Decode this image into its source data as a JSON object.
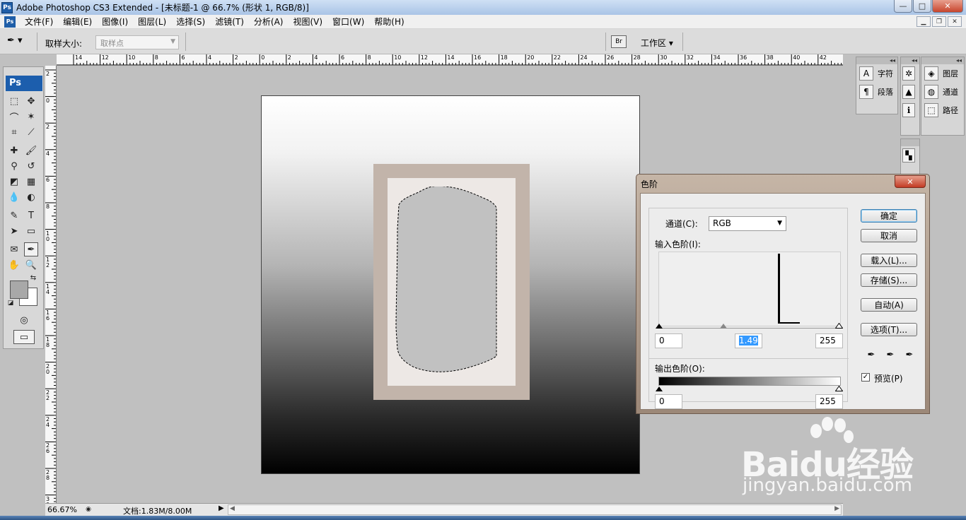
{
  "window": {
    "title": "Adobe Photoshop CS3 Extended - [未标题-1 @ 66.7% (形状 1, RGB/8)]",
    "minimize": "—",
    "maximize": "□",
    "close": "✕"
  },
  "menu": {
    "items": [
      "文件(F)",
      "编辑(E)",
      "图像(I)",
      "图层(L)",
      "选择(S)",
      "滤镜(T)",
      "分析(A)",
      "视图(V)",
      "窗口(W)",
      "帮助(H)"
    ]
  },
  "options_bar": {
    "sample_size_label": "取样大小:",
    "sample_size_value": "取样点",
    "workspace_label": "工作区 ▾"
  },
  "toolbox": {
    "logo": "Ps"
  },
  "rulers": {
    "top_labels": [
      "14",
      "12",
      "10",
      "8",
      "6",
      "4",
      "2",
      "0",
      "2",
      "4",
      "6",
      "8",
      "10",
      "12",
      "14",
      "16",
      "18",
      "20",
      "22",
      "24",
      "26",
      "28",
      "30",
      "32",
      "34",
      "36",
      "38",
      "40",
      "42"
    ],
    "left_labels": [
      "2",
      "0",
      "2",
      "4",
      "6",
      "8",
      "1 0",
      "1 2",
      "1 4",
      "1 6",
      "1 8",
      "2 0",
      "2 2",
      "2 4",
      "2 6",
      "2 8",
      "3 0"
    ]
  },
  "status": {
    "zoom": "66.67%",
    "doc_size": "文档:1.83M/8.00M"
  },
  "panels": {
    "col1": [
      {
        "icon": "A",
        "label": "字符"
      },
      {
        "icon": "¶",
        "label": "段落"
      }
    ],
    "col3": [
      {
        "label": "图层"
      },
      {
        "label": "通道"
      },
      {
        "label": "路径"
      }
    ]
  },
  "levels_dialog": {
    "title": "色阶",
    "channel_label": "通道(C):",
    "channel_value": "RGB",
    "input_levels_label": "输入色阶(I):",
    "input_black": "0",
    "input_gamma": "1.49",
    "input_white": "255",
    "output_levels_label": "输出色阶(O):",
    "output_black": "0",
    "output_white": "255",
    "buttons": {
      "ok": "确定",
      "cancel": "取消",
      "load": "载入(L)...",
      "save": "存储(S)...",
      "auto": "自动(A)",
      "options": "选项(T)..."
    },
    "preview_label": "预览(P)",
    "preview_checked": "✓"
  },
  "watermark": {
    "logo": "Baidu经验",
    "url": "jingyan.baidu.com"
  }
}
